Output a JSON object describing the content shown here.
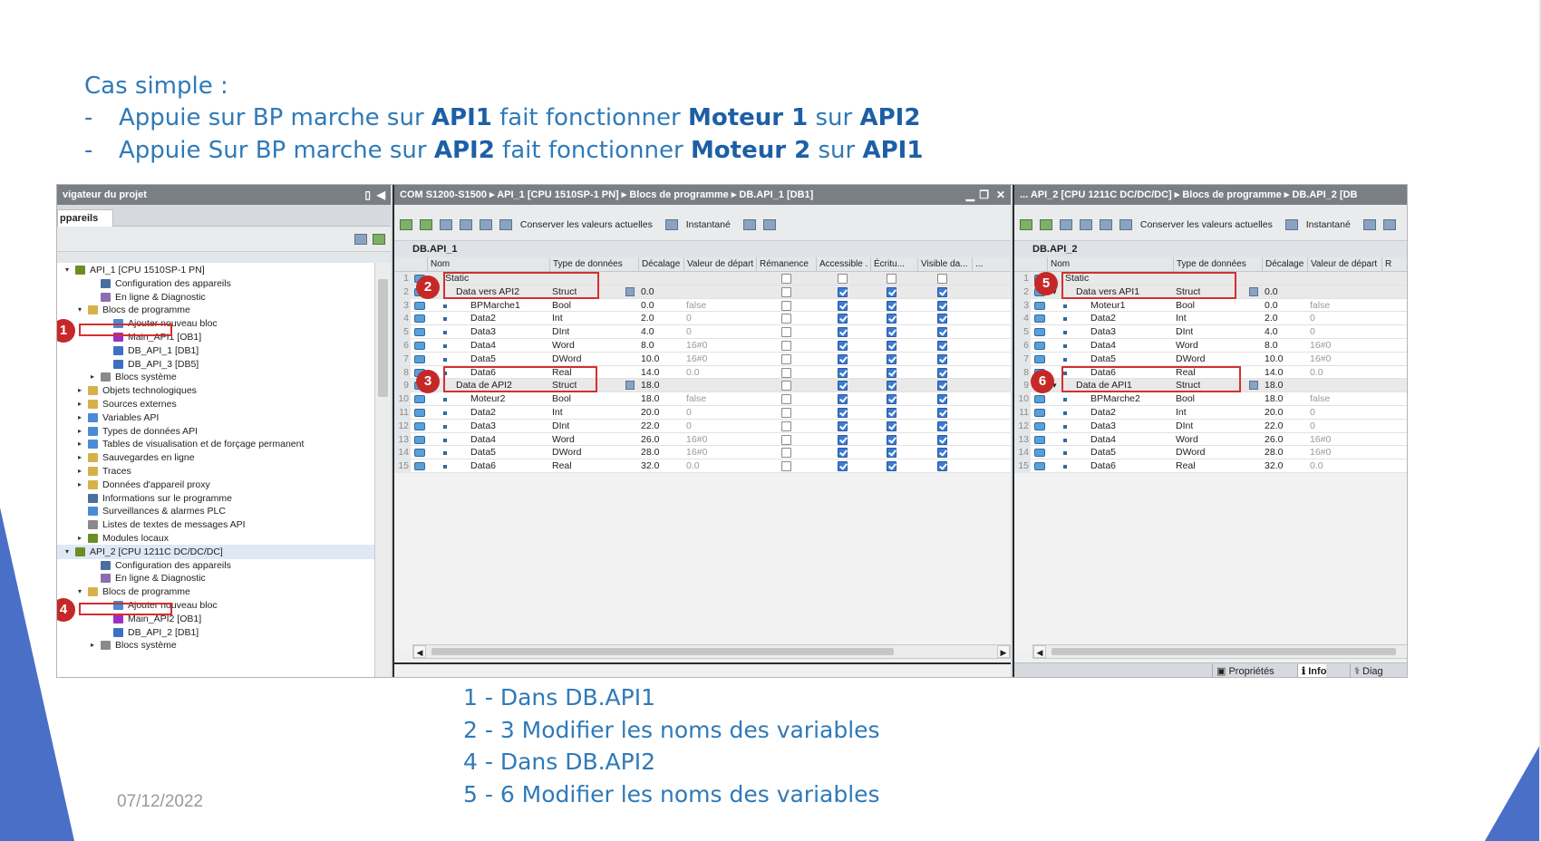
{
  "slide": {
    "heading": "Cas simple :",
    "bullets": [
      {
        "dash": "-",
        "t1": "Appuie sur BP marche sur ",
        "b1": "API1",
        "t2": " fait fonctionner ",
        "b2": "Moteur 1",
        "t3": " sur ",
        "b3": "API2"
      },
      {
        "dash": "-",
        "t1": "Appuie Sur BP marche sur ",
        "b1": "API2",
        "t2": " fait fonctionner ",
        "b2": "Moteur 2",
        "t3": " sur ",
        "b3": "API1"
      }
    ],
    "date": "07/12/2022"
  },
  "steps": [
    "1 - Dans DB.API1",
    "2 - 3 Modifier les noms des variables",
    "4 - Dans DB.API2",
    "5 - 6 Modifier les noms des variables"
  ],
  "nav": {
    "title": "vigateur du projet",
    "tab": "ppareils",
    "items": [
      {
        "label": "API_1 [CPU 1510SP-1 PN]",
        "level": 0,
        "arrow": "▾",
        "icon": "plc-icon",
        "color": "#6b8e23"
      },
      {
        "label": "Configuration des appareils",
        "level": 2,
        "arrow": "",
        "icon": "device-config-icon",
        "color": "#4a6f9f"
      },
      {
        "label": "En ligne & Diagnostic",
        "level": 2,
        "arrow": "",
        "icon": "online-diag-icon",
        "color": "#8a6fb0"
      },
      {
        "label": "Blocs de programme",
        "level": 1,
        "arrow": "▾",
        "icon": "folder-icon",
        "color": "#d8b04a"
      },
      {
        "label": "Ajouter nouveau bloc",
        "level": 3,
        "arrow": "",
        "icon": "add-block-icon",
        "color": "#4a8ad8"
      },
      {
        "label": "Main_API1 [OB1]",
        "level": 3,
        "arrow": "",
        "icon": "ob-icon",
        "color": "#9b30c0"
      },
      {
        "label": "DB_API_1 [DB1]",
        "level": 3,
        "arrow": "",
        "icon": "db-icon",
        "color": "#3e6fc6",
        "selected": true
      },
      {
        "label": "DB_API_3 [DB5]",
        "level": 3,
        "arrow": "",
        "icon": "db-icon",
        "color": "#3e6fc6"
      },
      {
        "label": "Blocs système",
        "level": 2,
        "arrow": "▸",
        "icon": "folder-icon",
        "color": "#8a8a8a"
      },
      {
        "label": "Objets technologiques",
        "level": 1,
        "arrow": "▸",
        "icon": "tech-object-icon",
        "color": "#d8b04a"
      },
      {
        "label": "Sources externes",
        "level": 1,
        "arrow": "▸",
        "icon": "folder-icon",
        "color": "#d8b04a"
      },
      {
        "label": "Variables API",
        "level": 1,
        "arrow": "▸",
        "icon": "tag-table-icon",
        "color": "#4a8ad8"
      },
      {
        "label": "Types de données API",
        "level": 1,
        "arrow": "▸",
        "icon": "datatype-icon",
        "color": "#4a8ad8"
      },
      {
        "label": "Tables de visualisation et de forçage permanent",
        "level": 1,
        "arrow": "▸",
        "icon": "watch-table-icon",
        "color": "#4a8ad8"
      },
      {
        "label": "Sauvegardes en ligne",
        "level": 1,
        "arrow": "▸",
        "icon": "backup-icon",
        "color": "#d8b04a"
      },
      {
        "label": "Traces",
        "level": 1,
        "arrow": "▸",
        "icon": "folder-icon",
        "color": "#d8b04a"
      },
      {
        "label": "Données d'appareil proxy",
        "level": 1,
        "arrow": "▸",
        "icon": "proxy-icon",
        "color": "#d8b04a"
      },
      {
        "label": "Informations sur le programme",
        "level": 1,
        "arrow": "",
        "icon": "program-info-icon",
        "color": "#4a6f9f"
      },
      {
        "label": "Surveillances & alarmes PLC",
        "level": 1,
        "arrow": "",
        "icon": "alarm-icon",
        "color": "#4a8ad8"
      },
      {
        "label": "Listes de textes de messages API",
        "level": 1,
        "arrow": "",
        "icon": "text-list-icon",
        "color": "#8a8a8a"
      },
      {
        "label": "Modules locaux",
        "level": 1,
        "arrow": "▸",
        "icon": "module-icon",
        "color": "#6b8e23"
      },
      {
        "label": "API_2 [CPU 1211C DC/DC/DC]",
        "level": 0,
        "arrow": "▾",
        "icon": "plc-icon",
        "color": "#6b8e23",
        "band": true
      },
      {
        "label": "Configuration des appareils",
        "level": 2,
        "arrow": "",
        "icon": "device-config-icon",
        "color": "#4a6f9f"
      },
      {
        "label": "En ligne & Diagnostic",
        "level": 2,
        "arrow": "",
        "icon": "online-diag-icon",
        "color": "#8a6fb0"
      },
      {
        "label": "Blocs de programme",
        "level": 1,
        "arrow": "▾",
        "icon": "folder-icon",
        "color": "#d8b04a"
      },
      {
        "label": "Ajouter nouveau bloc",
        "level": 3,
        "arrow": "",
        "icon": "add-block-icon",
        "color": "#4a8ad8"
      },
      {
        "label": "Main_API2 [OB1]",
        "level": 3,
        "arrow": "",
        "icon": "ob-icon",
        "color": "#9b30c0"
      },
      {
        "label": "DB_API_2 [DB1]",
        "level": 3,
        "arrow": "",
        "icon": "db-icon",
        "color": "#3e6fc6",
        "selected": true
      },
      {
        "label": "Blocs système",
        "level": 2,
        "arrow": "▸",
        "icon": "folder-icon",
        "color": "#8a8a8a"
      }
    ]
  },
  "db1": {
    "breadcrumb": "COM S1200-S1500  ▸  API_1 [CPU 1510SP-1 PN]  ▸  Blocs de programme  ▸  DB.API_1 [DB1]",
    "name": "DB.API_1",
    "toolbar": {
      "keep": "Conserver les valeurs actuelles",
      "snapshot": "Instantané"
    },
    "columns": [
      "Nom",
      "Type de données",
      "Décalage",
      "Valeur de départ",
      "Rémanence",
      "Accessible ...",
      "Écritu...",
      "Visible da...",
      "..."
    ],
    "rows": [
      {
        "n": "1",
        "name": "Static",
        "type": "",
        "off": "",
        "start": "",
        "kind": "section",
        "flags": [
          false,
          false,
          false,
          false
        ]
      },
      {
        "n": "2",
        "name": "Data vers API2",
        "type": "Struct",
        "off": "0.0",
        "start": "",
        "kind": "struct",
        "flags": [
          false,
          true,
          true,
          true
        ]
      },
      {
        "n": "3",
        "name": "BPMarche1",
        "type": "Bool",
        "off": "0.0",
        "start": "false",
        "kind": "member",
        "flags": [
          false,
          true,
          true,
          true
        ]
      },
      {
        "n": "4",
        "name": "Data2",
        "type": "Int",
        "off": "2.0",
        "start": "0",
        "kind": "member",
        "flags": [
          false,
          true,
          true,
          true
        ]
      },
      {
        "n": "5",
        "name": "Data3",
        "type": "DInt",
        "off": "4.0",
        "start": "0",
        "kind": "member",
        "flags": [
          false,
          true,
          true,
          true
        ]
      },
      {
        "n": "6",
        "name": "Data4",
        "type": "Word",
        "off": "8.0",
        "start": "16#0",
        "kind": "member",
        "flags": [
          false,
          true,
          true,
          true
        ]
      },
      {
        "n": "7",
        "name": "Data5",
        "type": "DWord",
        "off": "10.0",
        "start": "16#0",
        "kind": "member",
        "flags": [
          false,
          true,
          true,
          true
        ]
      },
      {
        "n": "8",
        "name": "Data6",
        "type": "Real",
        "off": "14.0",
        "start": "0.0",
        "kind": "member",
        "flags": [
          false,
          true,
          true,
          true
        ]
      },
      {
        "n": "9",
        "name": "Data de API2",
        "type": "Struct",
        "off": "18.0",
        "start": "",
        "kind": "struct",
        "flags": [
          false,
          true,
          true,
          true
        ]
      },
      {
        "n": "10",
        "name": "Moteur2",
        "type": "Bool",
        "off": "18.0",
        "start": "false",
        "kind": "member",
        "flags": [
          false,
          true,
          true,
          true
        ]
      },
      {
        "n": "11",
        "name": "Data2",
        "type": "Int",
        "off": "20.0",
        "start": "0",
        "kind": "member",
        "flags": [
          false,
          true,
          true,
          true
        ]
      },
      {
        "n": "12",
        "name": "Data3",
        "type": "DInt",
        "off": "22.0",
        "start": "0",
        "kind": "member",
        "flags": [
          false,
          true,
          true,
          true
        ]
      },
      {
        "n": "13",
        "name": "Data4",
        "type": "Word",
        "off": "26.0",
        "start": "16#0",
        "kind": "member",
        "flags": [
          false,
          true,
          true,
          true
        ]
      },
      {
        "n": "14",
        "name": "Data5",
        "type": "DWord",
        "off": "28.0",
        "start": "16#0",
        "kind": "member",
        "flags": [
          false,
          true,
          true,
          true
        ]
      },
      {
        "n": "15",
        "name": "Data6",
        "type": "Real",
        "off": "32.0",
        "start": "0.0",
        "kind": "member",
        "flags": [
          false,
          true,
          true,
          true
        ]
      }
    ]
  },
  "db2": {
    "breadcrumb": "... API_2 [CPU 1211C DC/DC/DC]  ▸  Blocs de programme  ▸  DB.API_2 [DB",
    "name": "DB.API_2",
    "toolbar": {
      "keep": "Conserver les valeurs actuelles",
      "snapshot": "Instantané"
    },
    "columns": [
      "Nom",
      "Type de données",
      "Décalage",
      "Valeur de départ",
      "R"
    ],
    "rows": [
      {
        "n": "1",
        "name": "Static",
        "type": "",
        "off": "",
        "start": "",
        "kind": "section"
      },
      {
        "n": "2",
        "name": "Data vers API1",
        "type": "Struct",
        "off": "0.0",
        "start": "",
        "kind": "struct"
      },
      {
        "n": "3",
        "name": "Moteur1",
        "type": "Bool",
        "off": "0.0",
        "start": "false",
        "kind": "member"
      },
      {
        "n": "4",
        "name": "Data2",
        "type": "Int",
        "off": "2.0",
        "start": "0",
        "kind": "member"
      },
      {
        "n": "5",
        "name": "Data3",
        "type": "DInt",
        "off": "4.0",
        "start": "0",
        "kind": "member"
      },
      {
        "n": "6",
        "name": "Data4",
        "type": "Word",
        "off": "8.0",
        "start": "16#0",
        "kind": "member"
      },
      {
        "n": "7",
        "name": "Data5",
        "type": "DWord",
        "off": "10.0",
        "start": "16#0",
        "kind": "member"
      },
      {
        "n": "8",
        "name": "Data6",
        "type": "Real",
        "off": "14.0",
        "start": "0.0",
        "kind": "member"
      },
      {
        "n": "9",
        "name": "Data de API1",
        "type": "Struct",
        "off": "18.0",
        "start": "",
        "kind": "struct"
      },
      {
        "n": "10",
        "name": "BPMarche2",
        "type": "Bool",
        "off": "18.0",
        "start": "false",
        "kind": "member"
      },
      {
        "n": "11",
        "name": "Data2",
        "type": "Int",
        "off": "20.0",
        "start": "0",
        "kind": "member"
      },
      {
        "n": "12",
        "name": "Data3",
        "type": "DInt",
        "off": "22.0",
        "start": "0",
        "kind": "member"
      },
      {
        "n": "13",
        "name": "Data4",
        "type": "Word",
        "off": "26.0",
        "start": "16#0",
        "kind": "member"
      },
      {
        "n": "14",
        "name": "Data5",
        "type": "DWord",
        "off": "28.0",
        "start": "16#0",
        "kind": "member"
      },
      {
        "n": "15",
        "name": "Data6",
        "type": "Real",
        "off": "32.0",
        "start": "0.0",
        "kind": "member"
      }
    ]
  },
  "status": {
    "properties": "Propriétés",
    "info": "Info",
    "diag": "Diag"
  },
  "badges": [
    "1",
    "2",
    "3",
    "4",
    "5",
    "6"
  ],
  "colors": {
    "accent": "#2f7ab8",
    "highlight": "#d32f2f",
    "badge": "#c62828",
    "checkbox": "#3a7bd5"
  }
}
